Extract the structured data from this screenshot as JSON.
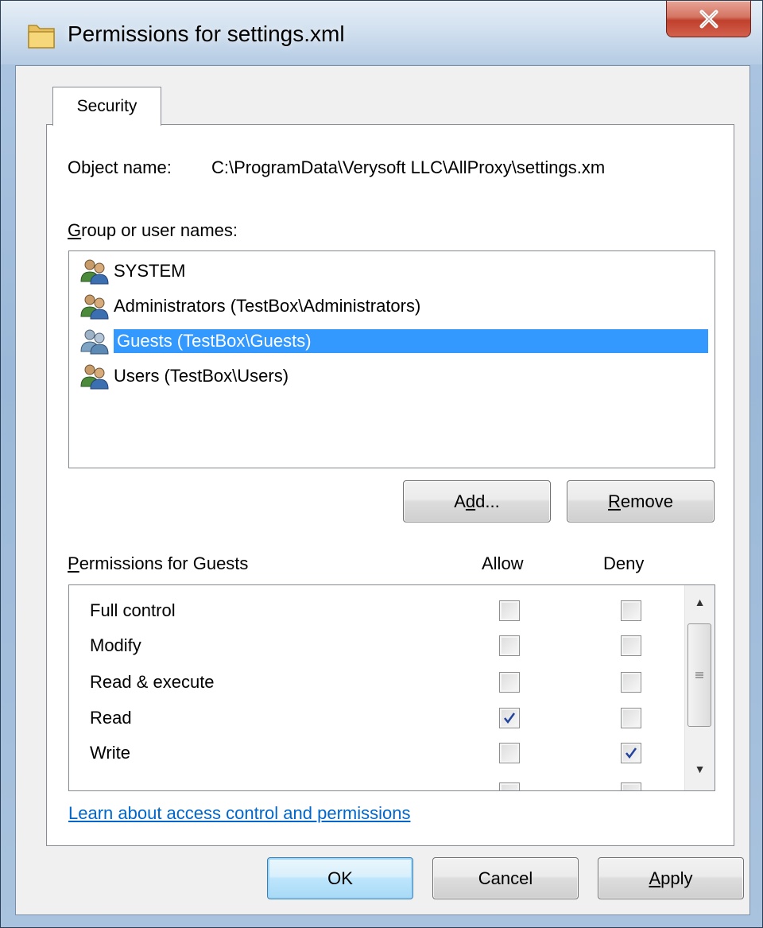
{
  "window": {
    "title": "Permissions for settings.xml"
  },
  "tabs": [
    {
      "label": "Security"
    }
  ],
  "object_name": {
    "label": "Object name:",
    "value": "C:\\ProgramData\\Verysoft LLC\\AllProxy\\settings.xm"
  },
  "groups": {
    "label_prefix": "G",
    "label_rest": "roup or user names:",
    "items": [
      {
        "label": "SYSTEM",
        "selected": false
      },
      {
        "label": "Administrators (TestBox\\Administrators)",
        "selected": false
      },
      {
        "label": "Guests (TestBox\\Guests)",
        "selected": true
      },
      {
        "label": "Users (TestBox\\Users)",
        "selected": false
      }
    ]
  },
  "buttons": {
    "add": {
      "pre": "A",
      "key": "d",
      "post": "d..."
    },
    "remove": {
      "key": "R",
      "post": "emove"
    }
  },
  "permissions": {
    "label_key": "P",
    "label_rest": "ermissions for Guests",
    "allow_header": "Allow",
    "deny_header": "Deny",
    "rows": [
      {
        "label": "Full control",
        "allow": false,
        "deny": false
      },
      {
        "label": "Modify",
        "allow": false,
        "deny": false
      },
      {
        "label": "Read & execute",
        "allow": false,
        "deny": false
      },
      {
        "label": "Read",
        "allow": true,
        "deny": false
      },
      {
        "label": "Write",
        "allow": false,
        "deny": true
      }
    ]
  },
  "link": {
    "text": "Learn about access control and permissions"
  },
  "footer": {
    "ok": "OK",
    "cancel": "Cancel",
    "apply_key": "A",
    "apply_rest": "pply"
  },
  "colors": {
    "selection": "#3399ff",
    "link": "#0066cc",
    "close": "#c0402c"
  }
}
